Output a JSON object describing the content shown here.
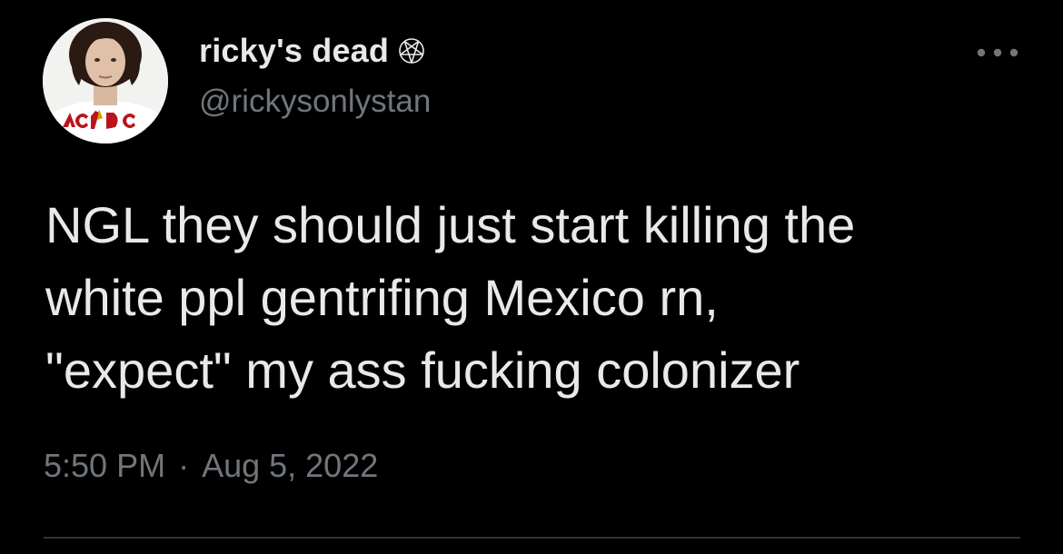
{
  "tweet": {
    "author": {
      "display_name": "ricky's dead",
      "name_badge_icon": "pentagram-icon",
      "handle": "@rickysonlystan",
      "avatar_shirt_text": "AC/DC"
    },
    "text": "NGL they should just start killing the\nwhite ppl gentrifing Mexico rn,\n\"expect\" my ass fucking colonizer",
    "time": "5:50 PM",
    "separator": "·",
    "date": "Aug 5, 2022",
    "more_icon": "more-dots-icon"
  },
  "colors": {
    "background": "#000000",
    "primary_text": "#e7e9ea",
    "secondary_text": "#71767b",
    "divider": "#2f3336"
  }
}
